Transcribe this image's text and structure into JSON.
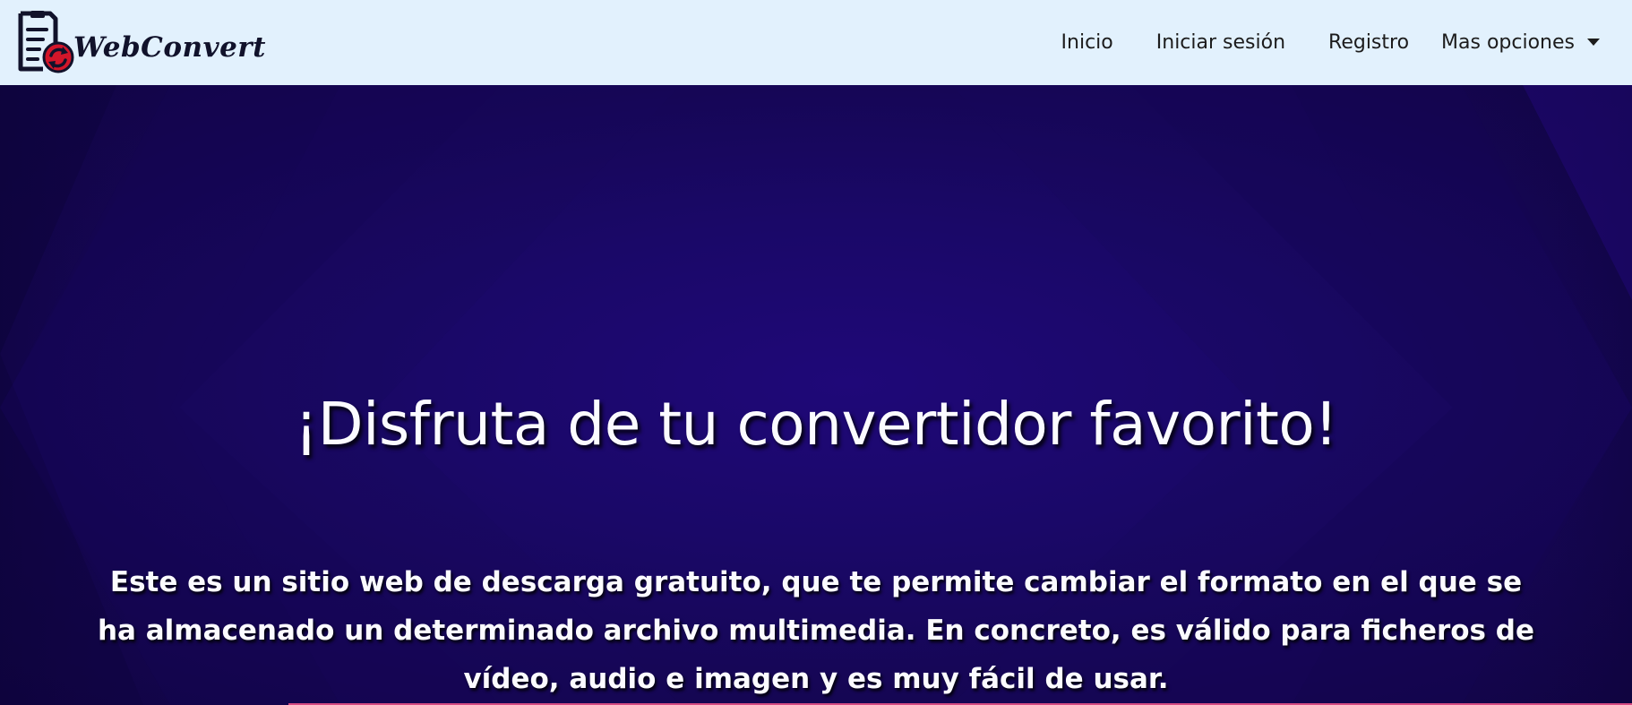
{
  "brand": {
    "name": "WebConvert",
    "logo_icon": "document-sync-icon"
  },
  "nav": {
    "items": [
      {
        "label": "Inicio"
      },
      {
        "label": "Iniciar sesión"
      },
      {
        "label": "Registro"
      }
    ],
    "dropdown": {
      "label": "Mas opciones",
      "icon": "caret-down-icon"
    }
  },
  "hero": {
    "title": "¡Disfruta de tu convertidor favorito!",
    "description": "Este es un sitio web de descarga gratuito, que te permite cambiar el formato en el que se ha almacenado un determinado archivo multimedia. En concreto, es válido para ficheros de vídeo, audio e imagen y es muy fácil de usar."
  },
  "colors": {
    "navbar_bg": "#e2f1fd",
    "hero_bg": "#1a0868",
    "logo_accent": "#d3162a",
    "text_light": "#fbfbff"
  }
}
